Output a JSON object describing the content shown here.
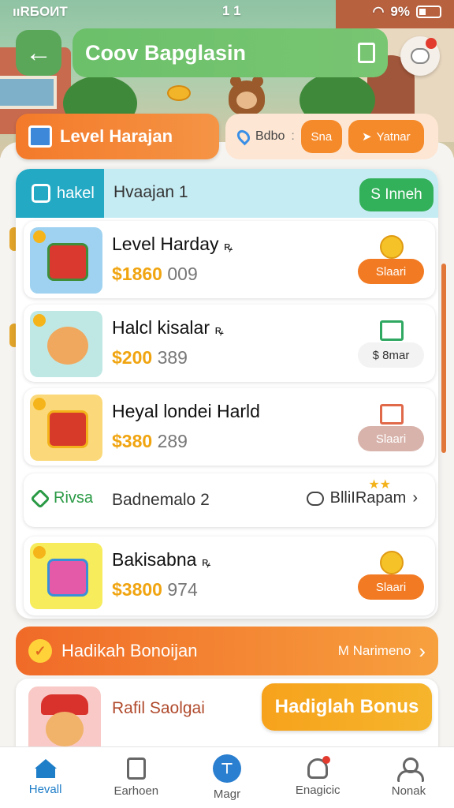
{
  "status_bar": {
    "left": "ııRБOИT",
    "carrier_icon": "wifi-s-icon",
    "middle": "1 1",
    "battery": "9%"
  },
  "topbar": {
    "title": "Coov Bapglasin",
    "back_icon": "arrow-left-icon",
    "bookmark_icon": "bookmark-icon",
    "chat_icon": "chat-bubble-icon"
  },
  "level_pill": {
    "label": "Level Harajan",
    "icon": "box-icon"
  },
  "filter": {
    "text": "Bdbo",
    "dot": ":",
    "chip1": "Sna",
    "chip2": "Yatnar"
  },
  "card": {
    "tab_label": "hakel",
    "header_title": "Hvaajan 1",
    "green_button": "S Inneh"
  },
  "rows": [
    {
      "title": "Level Harday",
      "mark": "ꝶ",
      "price_gold": "$1860",
      "price_grey": "009",
      "action": "Slaari",
      "action_style": "orange",
      "icon": "coin-icon"
    },
    {
      "title": "Halcl kisalar",
      "mark": "ꝶ",
      "price_gold": "$200",
      "price_grey": "389",
      "action": "$ 8mar",
      "action_style": "light",
      "icon": "document-icon"
    },
    {
      "title": "Heyal londei Harld",
      "mark": "",
      "price_gold": "$380",
      "price_grey": "289",
      "action": "Slaari",
      "action_style": "muted",
      "icon": "document-icon"
    },
    {
      "title": "Bakisabna",
      "mark": "ꝶ",
      "price_gold": "$3800",
      "price_grey": "974",
      "action": "Slaari",
      "action_style": "orange",
      "icon": "coin-icon"
    }
  ],
  "info_row": {
    "left_label": "Rivsa",
    "title": "Badnemalo 2",
    "right_label": "BlliIRapam",
    "chevron": "›"
  },
  "bonus_banner": {
    "label": "Hadikah Bonoijan",
    "right_label": "M Narimeno",
    "chevron": "›"
  },
  "bonus_card": {
    "title": "Rafil Saolgai",
    "button": "Hadiglah Bonus"
  },
  "nav": [
    {
      "label": "Hevall",
      "icon": "home-icon",
      "active": true
    },
    {
      "label": "Earhoen",
      "icon": "ledger-icon",
      "active": false
    },
    {
      "label": "Magr",
      "icon": "magic-icon",
      "active": false
    },
    {
      "label": "Enagicic",
      "icon": "bell-icon",
      "active": false
    },
    {
      "label": "Nonak",
      "icon": "user-icon",
      "active": false
    }
  ],
  "colors": {
    "accent_orange": "#f37a2a",
    "accent_green": "#33b05a",
    "accent_teal": "#23a9c4",
    "gold": "#f0a410",
    "nav_active": "#1f7ec8"
  }
}
